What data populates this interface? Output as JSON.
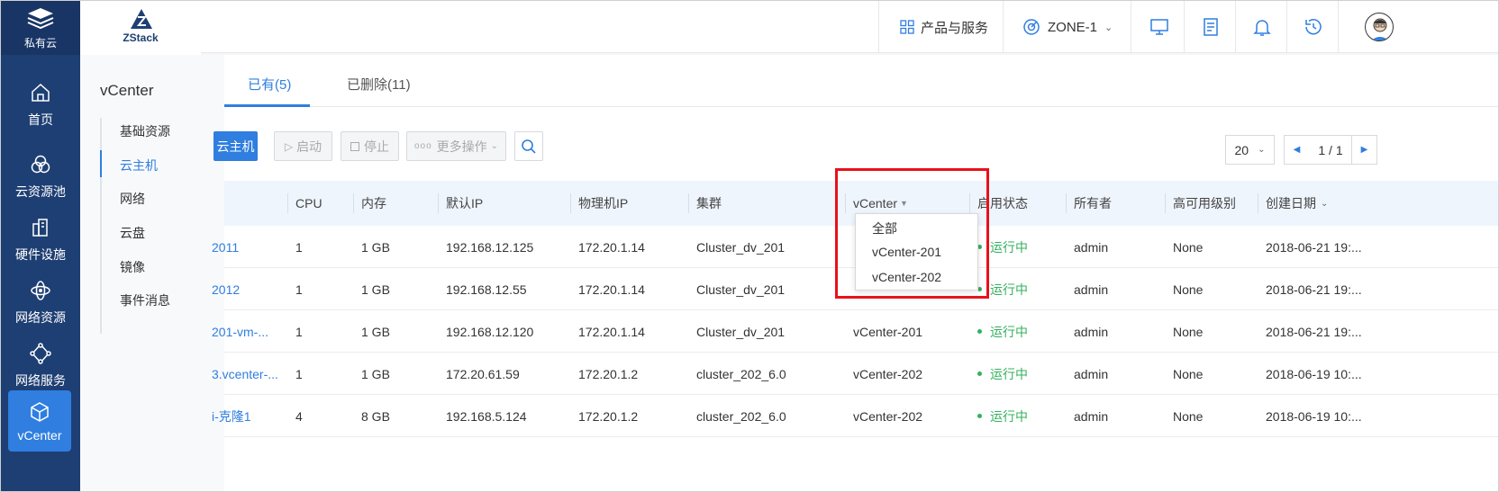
{
  "sidebar": {
    "brand_label": "私有云",
    "items": [
      {
        "label": "首页",
        "icon": "home-icon"
      },
      {
        "label": "云资源池",
        "icon": "resource-pool-icon"
      },
      {
        "label": "硬件设施",
        "icon": "hardware-icon"
      },
      {
        "label": "网络资源",
        "icon": "network-resource-icon"
      },
      {
        "label": "网络服务",
        "icon": "network-service-icon"
      },
      {
        "label": "vCenter",
        "icon": "cube-icon",
        "active": true
      }
    ]
  },
  "logo_text": "ZStack",
  "header": {
    "products_label": "产品与服务",
    "zone_label": "ZONE-1"
  },
  "subpanel": {
    "title": "vCenter",
    "items": [
      "基础资源",
      "云主机",
      "网络",
      "云盘",
      "镜像",
      "事件消息"
    ],
    "active_index": 1
  },
  "tabs": [
    {
      "label": "已有(5)",
      "active": true
    },
    {
      "label": "已删除(11)",
      "active": false
    }
  ],
  "toolbar": {
    "create_label": "云主机",
    "start_label": "启动",
    "stop_label": "停止",
    "more_label": "更多操作"
  },
  "pager": {
    "page_size": "20",
    "page_info": "1 / 1"
  },
  "table": {
    "columns": [
      "CPU",
      "内存",
      "默认IP",
      "物理机IP",
      "集群",
      "vCenter",
      "启用状态",
      "所有者",
      "高可用级别",
      "创建日期"
    ],
    "rows": [
      {
        "name": "2011",
        "cpu": "1",
        "mem": "1 GB",
        "ip": "192.168.12.125",
        "host_ip": "172.20.1.14",
        "cluster": "Cluster_dv_201",
        "vcenter": "",
        "status": "运行中",
        "owner": "admin",
        "ha": "None",
        "date": "2018-06-21 19:..."
      },
      {
        "name": "2012",
        "cpu": "1",
        "mem": "1 GB",
        "ip": "192.168.12.55",
        "host_ip": "172.20.1.14",
        "cluster": "Cluster_dv_201",
        "vcenter": "",
        "status": "运行中",
        "owner": "admin",
        "ha": "None",
        "date": "2018-06-21 19:..."
      },
      {
        "name": "201-vm-...",
        "cpu": "1",
        "mem": "1 GB",
        "ip": "192.168.12.120",
        "host_ip": "172.20.1.14",
        "cluster": "Cluster_dv_201",
        "vcenter": "vCenter-201",
        "status": "运行中",
        "owner": "admin",
        "ha": "None",
        "date": "2018-06-21 19:..."
      },
      {
        "name": "3.vcenter-...",
        "cpu": "1",
        "mem": "1 GB",
        "ip": "172.20.61.59",
        "host_ip": "172.20.1.2",
        "cluster": "cluster_202_6.0",
        "vcenter": "vCenter-202",
        "status": "运行中",
        "owner": "admin",
        "ha": "None",
        "date": "2018-06-19 10:..."
      },
      {
        "name": "i-克隆1",
        "cpu": "4",
        "mem": "8 GB",
        "ip": "192.168.5.124",
        "host_ip": "172.20.1.2",
        "cluster": "cluster_202_6.0",
        "vcenter": "vCenter-202",
        "status": "运行中",
        "owner": "admin",
        "ha": "None",
        "date": "2018-06-19 10:..."
      }
    ]
  },
  "vcenter_filter": {
    "options": [
      "全部",
      "vCenter-201",
      "vCenter-202"
    ]
  },
  "colors": {
    "sidebar_bg": "#1e3f73",
    "accent": "#2f7ee0",
    "status_green": "#34b05e",
    "highlight_red": "#e8111c"
  }
}
